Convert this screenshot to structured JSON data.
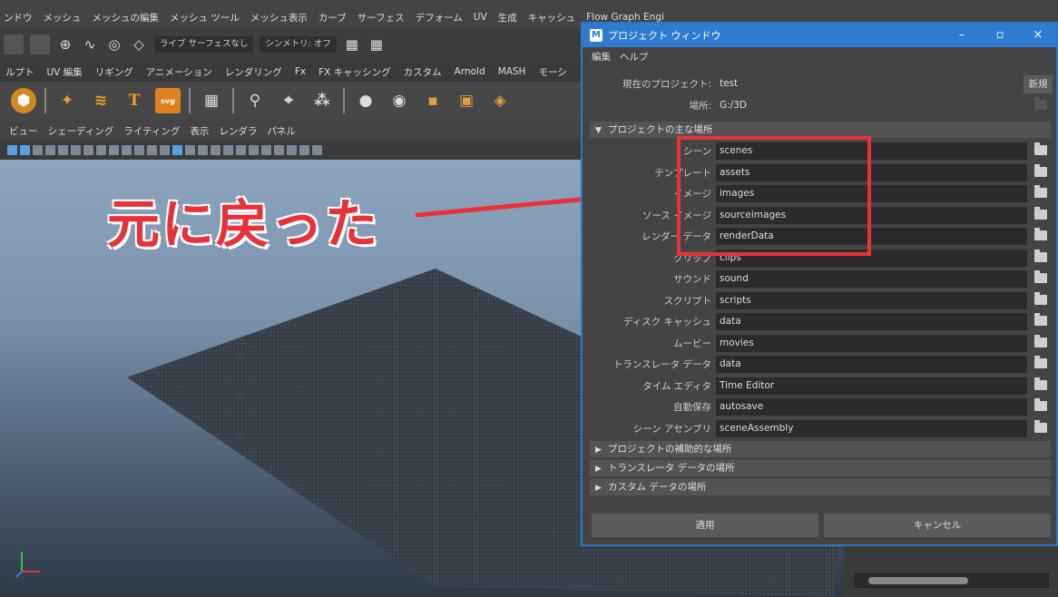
{
  "menubar": [
    "ンドウ",
    "メッシュ",
    "メッシュの編集",
    "メッシュ ツール",
    "メッシュ表示",
    "カーブ",
    "サーフェス",
    "デフォーム",
    "UV",
    "生成",
    "キャッシュ",
    "Flow Graph Engi"
  ],
  "statusline": {
    "live_label": "ライブ サーフェスなし",
    "symmetry_label": "シンメトリ: オフ"
  },
  "shelf_tabs": [
    "ルプト",
    "UV 編集",
    "リギング",
    "アニメーション",
    "レンダリング",
    "Fx",
    "FX キャッシング",
    "カスタム",
    "Arnold",
    "MASH",
    "モーシ"
  ],
  "panel_menu": [
    "ビュー",
    "シェーディング",
    "ライティング",
    "表示",
    "レンダラ",
    "パネル"
  ],
  "caption": "元に戻った",
  "colors": {
    "accent_red": "#e8323a",
    "title_blue": "#2e7bd0"
  },
  "dialog": {
    "title": "プロジェクト ウィンドウ",
    "menu": [
      "編集",
      "ヘルプ"
    ],
    "current_project_label": "現在のプロジェクト:",
    "current_project_value": "test",
    "new_button": "新規",
    "location_label": "場所:",
    "location_value": "G:/3D",
    "primary_section": "プロジェクトの主な場所",
    "rows": [
      {
        "label": "シーン",
        "value": "scenes"
      },
      {
        "label": "テンプレート",
        "value": "assets"
      },
      {
        "label": "イメージ",
        "value": "images"
      },
      {
        "label": "ソース イメージ",
        "value": "sourceimages"
      },
      {
        "label": "レンダー データ",
        "value": "renderData"
      },
      {
        "label": "クリップ",
        "value": "clips"
      },
      {
        "label": "サウンド",
        "value": "sound"
      },
      {
        "label": "スクリプト",
        "value": "scripts"
      },
      {
        "label": "ディスク キャッシュ",
        "value": "data"
      },
      {
        "label": "ムービー",
        "value": "movies"
      },
      {
        "label": "トランスレータ データ",
        "value": "data"
      },
      {
        "label": "タイム エディタ",
        "value": "Time Editor"
      },
      {
        "label": "自動保存",
        "value": "autosave"
      },
      {
        "label": "シーン アセンブリ",
        "value": "sceneAssembly"
      }
    ],
    "secondary_section": "プロジェクトの補助的な場所",
    "translator_section": "トランスレータ データの場所",
    "custom_section": "カスタム データの場所",
    "apply_button": "適用",
    "cancel_button": "キャンセル"
  }
}
